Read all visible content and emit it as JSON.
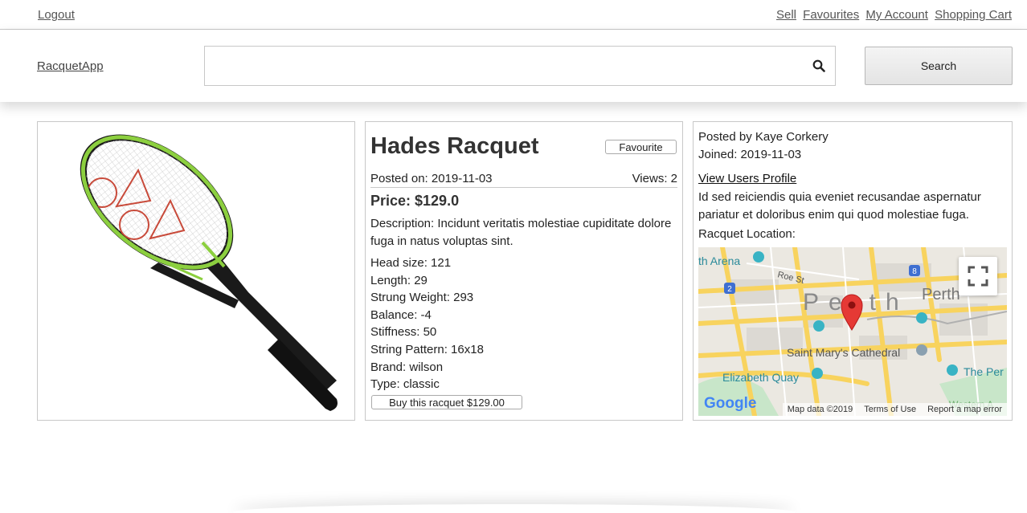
{
  "topbar": {
    "logout": "Logout",
    "links": [
      "Sell",
      "Favourites",
      "My Account",
      "Shopping Cart"
    ]
  },
  "header": {
    "brand": "RacquetApp",
    "search_placeholder": "",
    "search_button": "Search"
  },
  "listing": {
    "title": "Hades Racquet",
    "favourite_button": "Favourite",
    "posted_on": "Posted on: 2019-11-03",
    "views": "Views: 2",
    "price": "Price: $129.0",
    "description": "Description: Incidunt veritatis molestiae cupiditate dolore fuga in natus voluptas sint.",
    "specs": [
      "Head size: 121",
      "Length: 29",
      "Strung Weight: 293",
      "Balance: -4",
      "Stiffness: 50",
      "String Pattern: 16x18",
      "Brand: wilson",
      "Type: classic"
    ],
    "buy_button": "Buy this racquet $129.00"
  },
  "seller": {
    "posted_by": "Posted by Kaye Corkery",
    "joined": "Joined: 2019-11-03",
    "profile_link": "View Users Profile",
    "bio": "Id sed reiciendis quia eveniet recusandae aspernatur pariatur et doloribus enim qui quod molestiae fuga.",
    "location_label": "Racquet Location:"
  },
  "map": {
    "labels": {
      "arena": "th Arena",
      "roe": "Roe St",
      "perth_big": "Perth",
      "perth_right": "Perth",
      "cathedral": "Saint Mary's Cathedral",
      "quay": "Elizabeth Quay",
      "the_per": "The Per",
      "western": "Western A",
      "route_2": "2",
      "route_8": "8"
    },
    "google": "Google",
    "footer": [
      "Map data ©2019",
      "Terms of Use",
      "Report a map error"
    ]
  },
  "colors": {
    "racquet_frame": "#1a1a1a",
    "racquet_accent": "#8ccf3f",
    "logo_red": "#c84a3a",
    "map_road": "#f8d35e",
    "map_pin": "#e53935"
  }
}
